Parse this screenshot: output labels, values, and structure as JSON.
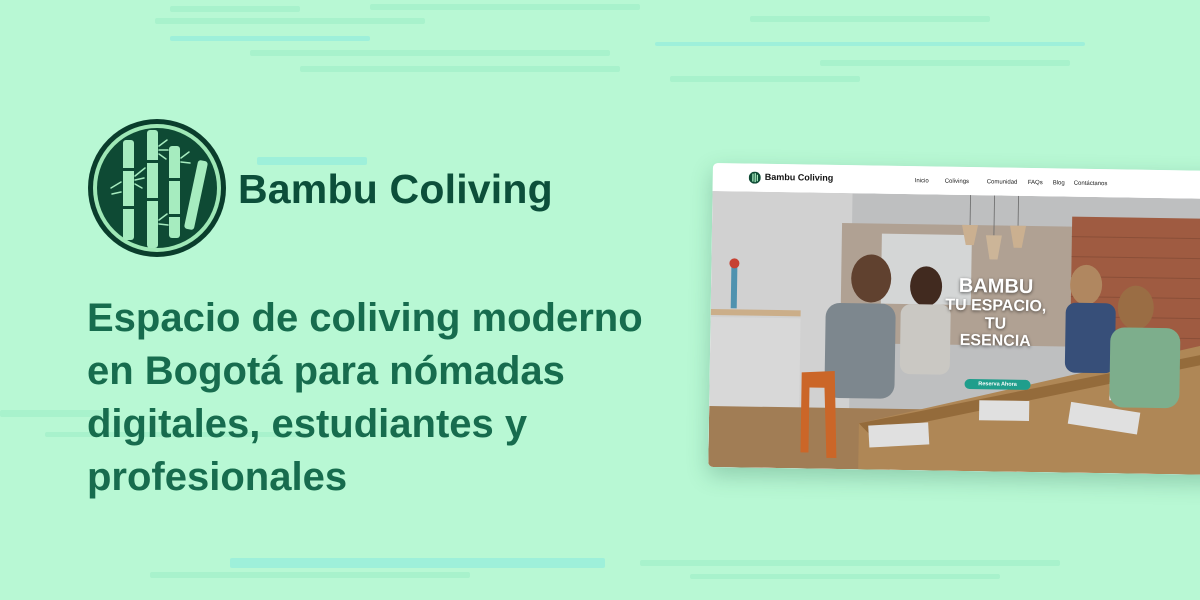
{
  "brand": {
    "name": "Bambu Coliving"
  },
  "headline": {
    "lines": [
      "Espacio de coliving moderno",
      "en Bogotá para nómadas",
      "digitales, estudiantes y",
      "profesionales"
    ]
  },
  "mockup": {
    "nav": {
      "brand": "Bambu Coliving",
      "links": [
        "Inicio",
        "Colivings",
        "Comunidad",
        "FAQs",
        "Blog",
        "Contáctanos"
      ]
    },
    "hero": {
      "title": "BAMBU",
      "tagline_lines": [
        "TU ESPACIO,",
        "TU",
        "ESENCIA"
      ],
      "cta": "Reserva Ahora"
    }
  },
  "colors": {
    "background": "#b8f8d4",
    "brand_dark": "#0c4f3a",
    "headline": "#176c4e",
    "cta": "#1f9e8c"
  },
  "icons": {
    "logo": "bamboo-logo-icon"
  }
}
